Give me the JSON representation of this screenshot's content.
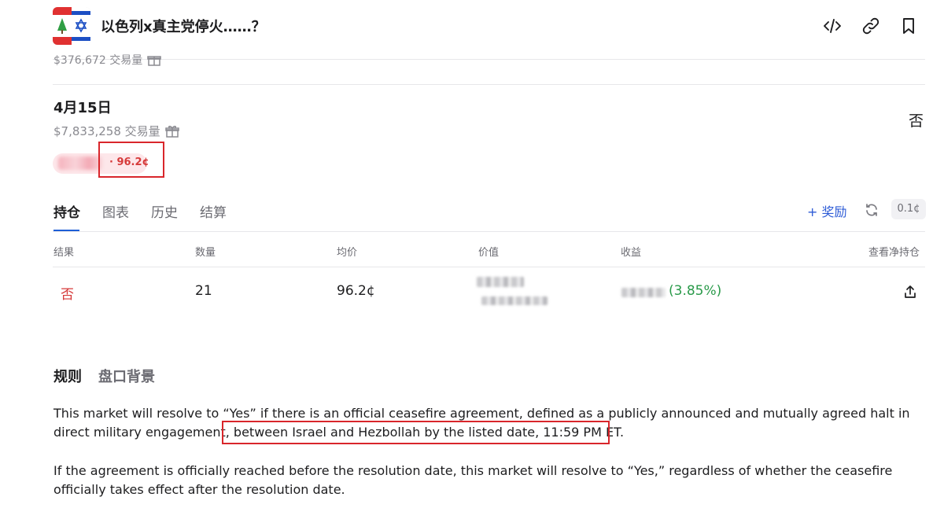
{
  "header": {
    "title": "以色列x真主党停火……？",
    "icons": [
      "code-embed-icon",
      "link-icon",
      "bookmark-icon"
    ]
  },
  "previous_row": {
    "volume": "$376,672 交易量"
  },
  "date_row": {
    "title": "4月15日",
    "volume": "$7,833,258 交易量",
    "side_label": "否",
    "pill_price": "· 96.2¢"
  },
  "tabs": [
    "持仓",
    "图表",
    "历史",
    "结算"
  ],
  "actions": {
    "reward": "+ 奖励",
    "tick": "0.1¢"
  },
  "table": {
    "headers": [
      "结果",
      "数量",
      "均价",
      "价值",
      "收益",
      "查看净持仓"
    ],
    "row": {
      "outcome": "否",
      "quantity": "21",
      "avg_price": "96.2¢",
      "gain_pct": "(3.85%)"
    }
  },
  "rules": {
    "tabs": [
      "规则",
      "盘口背景"
    ],
    "p1_a": "This market will resolve to “Yes” if there is an official ceasefire agreement, defined as a publicly announced and mutually agreed halt in direct military engagement,",
    "p1_b": " between Israel and Hezbollah by the listed date, 11:59 PM ET.",
    "p2": "If the agreement is officially reached before the resolution date, this market will resolve to “Yes,” regardless of whether the ceasefire officially takes effect after the resolution date."
  },
  "colors": {
    "accent": "#2d5bd6",
    "no": "#d63a3a",
    "gain": "#2a9a4a",
    "highlight_box": "#d9262b"
  }
}
